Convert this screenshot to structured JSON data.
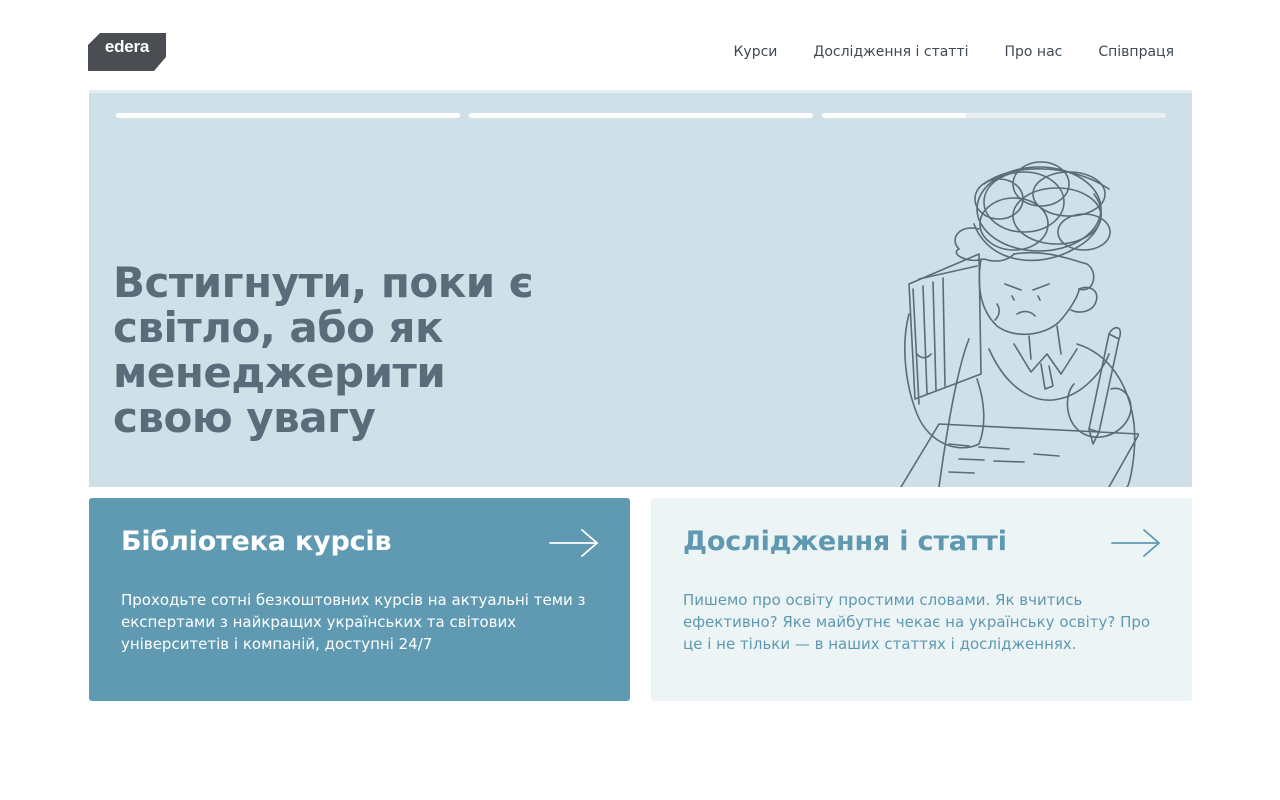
{
  "brand": {
    "logo_text": "edera"
  },
  "nav": {
    "items": [
      {
        "label": "Курси"
      },
      {
        "label": "Дослідження і статті"
      },
      {
        "label": "Про нас"
      },
      {
        "label": "Співпраця"
      }
    ]
  },
  "hero": {
    "title": "Встигнути, поки є світло, або як менеджерити свою увагу",
    "slides": [
      {
        "progress": 1.0
      },
      {
        "progress": 1.0
      },
      {
        "progress": 0.42
      }
    ]
  },
  "cards": {
    "courses": {
      "title": "Бібліотека курсів",
      "description": "Проходьте сотні безкоштовних курсів на актуальні теми з експертами з найкращих українських та світових університетів і компаній, доступні 24/7"
    },
    "research": {
      "title": "Дослідження і статті",
      "description": "Пишемо про освіту простими словами. Як вчитись ефективно? Яке майбутнє чекає на українську освіту? Про це і не тільки — в наших статтях і дослідженнях."
    }
  },
  "colors": {
    "hero_bg": "#cfe0e9",
    "card_primary": "#5f9ab2",
    "card_secondary": "#edf4f6",
    "logo_bg": "#4a4d52"
  }
}
